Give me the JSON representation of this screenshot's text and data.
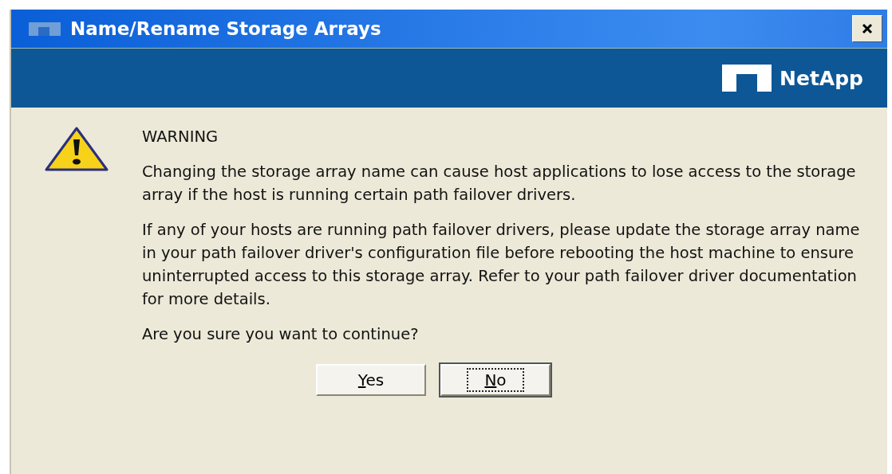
{
  "window": {
    "title": "Name/Rename Storage Arrays"
  },
  "banner": {
    "logo_text": "NetApp"
  },
  "message": {
    "heading": "WARNING",
    "paragraphs": [
      "Changing the storage array name can cause host applications to lose access to the storage array if the host is running certain path failover drivers.",
      "If any of your hosts are running path failover drivers, please update the storage array name in your path failover driver's configuration file before rebooting the host machine to ensure uninterrupted access to this storage array. Refer to your path failover driver documentation for more details.",
      "Are you sure you want to continue?"
    ]
  },
  "buttons": [
    {
      "label": "Yes",
      "focused": false
    },
    {
      "label": "No",
      "focused": true
    }
  ]
}
